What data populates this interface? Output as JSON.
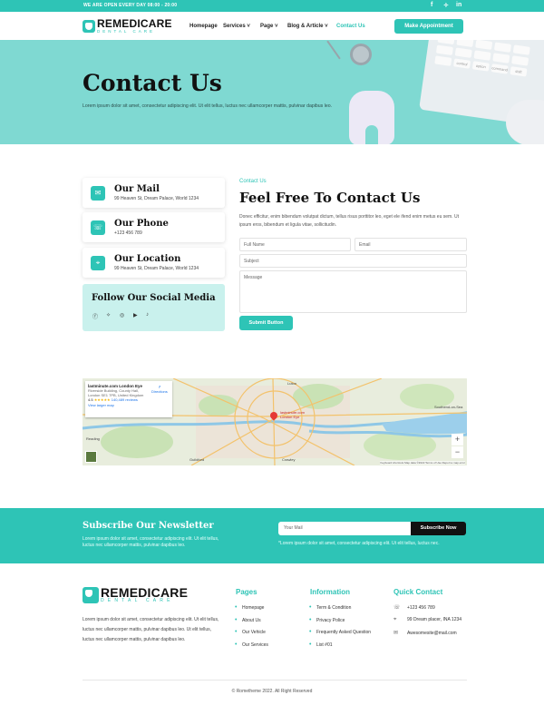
{
  "topbar": {
    "message": "WE ARE OPEN EVERY DAY 08:00 - 20:00",
    "social": [
      "f",
      "✧",
      "in"
    ]
  },
  "brand": {
    "name": "REMEDICARE",
    "tagline": "DENTAL CARE"
  },
  "nav": {
    "items": [
      {
        "label": "Homepage"
      },
      {
        "label": "Services ˅"
      },
      {
        "label": "Page ˅"
      },
      {
        "label": "Blog & Article ˅"
      },
      {
        "label": "Contact Us"
      }
    ],
    "cta": "Make Appointment"
  },
  "hero": {
    "title": "Contact Us",
    "text": "Lorem ipsum dolor sit amet, consectetur adipiscing elit. Ut elit tellus, luctus nec ullamcorper mattis, pulvinar dapibus leo.",
    "keyboard_keys": [
      "control",
      "option",
      "command",
      "shift"
    ]
  },
  "contact_cards": [
    {
      "title": "Our Mail",
      "value": "99 Heaven St, Dream Palace, World 1234",
      "icon": "mail-icon"
    },
    {
      "title": "Our Phone",
      "value": "+123 456 789",
      "icon": "phone-icon"
    },
    {
      "title": "Our Location",
      "value": "99 Heaven St, Dream Palace, World 1234",
      "icon": "map-icon"
    }
  ],
  "social": {
    "title": "Follow Our Social Media",
    "icons": [
      "facebook-icon",
      "twitter-icon",
      "instagram-icon",
      "youtube-icon",
      "tiktok-icon"
    ]
  },
  "form": {
    "eyebrow": "Contact Us",
    "heading": "Feel Free To Contact Us",
    "description": "Donec efficitur, enim bibendum volutpat dictum, tellus risus porttitor leo, eget ele ifend enim metus eu sem. Ut ipsum eros, bibendum et ligula vitae, sollicitudin.",
    "full_name_placeholder": "Full Name",
    "email_placeholder": "Email",
    "subject_placeholder": "Subject",
    "message_placeholder": "Message",
    "submit_label": "Submit Button"
  },
  "map": {
    "place_name": "lastminute.com London Eye",
    "address": "Riverside Building, County Hall, London SE1 7PB, United Kingdom",
    "rating": "4.5",
    "stars": "★★★★★",
    "reviews": "140,489 reviews",
    "directions": "Directions",
    "larger_map": "View larger map",
    "pin_label": "lastminute.com London Eye",
    "footer": "Keyboard shortcuts   Map data ©2022   Terms of Use   Report a map error",
    "zoom_in": "+",
    "zoom_out": "−",
    "places": [
      "Reading",
      "Luton",
      "Southend-on-Sea",
      "Guildford",
      "Crawley"
    ]
  },
  "newsletter": {
    "title": "Subscribe Our Newsletter",
    "text": "Lorem ipsum dolor sit amet, consectetur adipiscing elit. Ut elit tellus, luctus nec ullamcorper mattis, pulvinar dapibus leo.",
    "input_placeholder": "Your Mail",
    "button": "Subscribe Now",
    "note": "*Lorem ipsum dolor sit amet, consectetur adipiscing elit. Ut elit tellus, luctus nec."
  },
  "footer": {
    "about": "Lorem ipsum dolor sit amet, consectetur adipiscing elit. Ut elit tellus, luctus nec ullamcorper mattis, pulvinar dapibus leo. Ut elit tellus, luctus nec ullamcorper mattis, pulvinar dapibus leo.",
    "pages_title": "Pages",
    "pages": [
      "Homepage",
      "About Us",
      "Our Vehicle",
      "Our Services"
    ],
    "info_title": "Information",
    "info": [
      "Term & Condition",
      "Privacy Police",
      "Frequently Asked Question",
      "List #01"
    ],
    "contact_title": "Quick Contact",
    "contact": [
      {
        "icon": "phone-icon",
        "text": "+123 456 789"
      },
      {
        "icon": "map-icon",
        "text": "99 Dream placer, INA 1234"
      },
      {
        "icon": "mail-icon",
        "text": "Awesomesite@mail.com"
      }
    ],
    "copyright": "©  Rometheme 2022. All Right Reserved"
  }
}
